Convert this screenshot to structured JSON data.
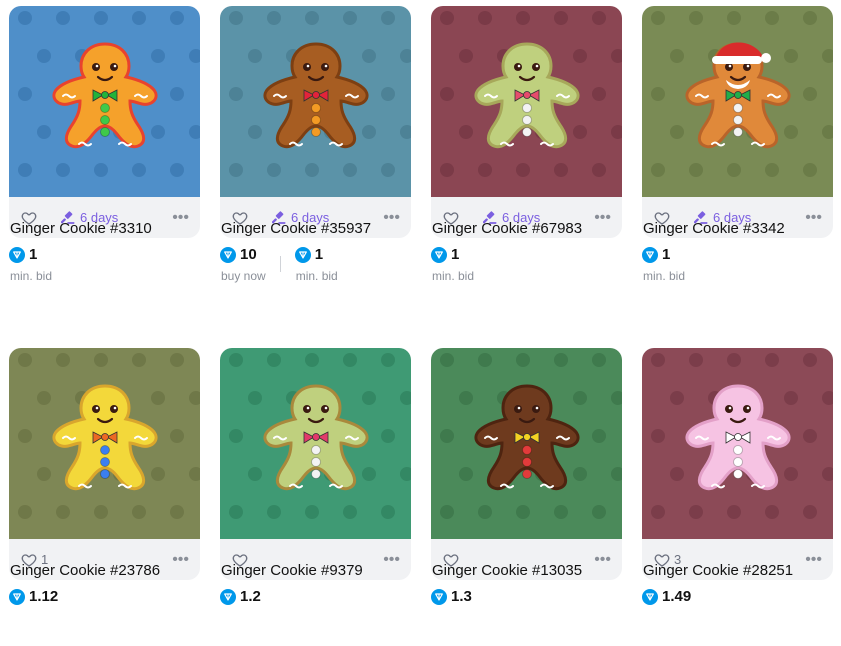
{
  "colors": {
    "accent": "#7b5fe0",
    "ton_blue": "#0098ea",
    "muted": "#8a8f98",
    "card_bar": "#f1f2f4"
  },
  "cards": [
    {
      "title": "Ginger Cookie #3310",
      "bg": "#4f8fc9",
      "pattern_color": "#3f7db6",
      "cookie_color": "#f5a12b",
      "cookie_edge": "#e8432e",
      "bow_color": "#22b33a",
      "button_color": "#3fc94a",
      "likes": "",
      "auction": "6 days",
      "prices": [
        {
          "value": "1",
          "label": "min. bid"
        }
      ]
    },
    {
      "title": "Ginger Cookie #35937",
      "bg": "#5b93a8",
      "pattern_color": "#4d8296",
      "cookie_color": "#a75d22",
      "cookie_edge": "#7d3f12",
      "bow_color": "#e3233a",
      "button_color": "#f39b24",
      "likes": "",
      "auction": "6 days",
      "prices": [
        {
          "value": "10",
          "label": "buy now"
        },
        {
          "value": "1",
          "label": "min. bid"
        }
      ]
    },
    {
      "title": "Ginger Cookie #67983",
      "bg": "#8b4653",
      "pattern_color": "#7a3a47",
      "cookie_color": "#bfd07e",
      "cookie_edge": "#a7a85a",
      "bow_color": "#e64c6c",
      "button_color": "#f3f3f3",
      "likes": "",
      "auction": "6 days",
      "prices": [
        {
          "value": "1",
          "label": "min. bid"
        }
      ]
    },
    {
      "title": "Ginger Cookie #3342",
      "bg": "#7a8b55",
      "pattern_color": "#6b7c48",
      "cookie_color": "#e0893a",
      "cookie_edge": "#b9642a",
      "bow_color": "#1fae4a",
      "button_color": "#f3f3f3",
      "likes": "",
      "auction": "6 days",
      "santa_hat": true,
      "prices": [
        {
          "value": "1",
          "label": "min. bid"
        }
      ]
    },
    {
      "title": "Ginger Cookie #23786",
      "bg": "#7e8755",
      "pattern_color": "#6f7848",
      "cookie_color": "#f3d83a",
      "cookie_edge": "#d9a62d",
      "bow_color": "#ec6a23",
      "button_color": "#3b7ff0",
      "likes": "1",
      "auction": "",
      "prices": [
        {
          "value": "1.12",
          "label": ""
        }
      ]
    },
    {
      "title": "Ginger Cookie #9379",
      "bg": "#3f9a74",
      "pattern_color": "#338864",
      "cookie_color": "#bfd07e",
      "cookie_edge": "#a9893c",
      "bow_color": "#e23a6a",
      "button_color": "#f3f3f3",
      "likes": "",
      "auction": "",
      "prices": [
        {
          "value": "1.2",
          "label": ""
        }
      ]
    },
    {
      "title": "Ginger Cookie #13035",
      "bg": "#4b8a5a",
      "pattern_color": "#3f7a4d",
      "cookie_color": "#6e3a1e",
      "cookie_edge": "#4e2410",
      "bow_color": "#f3d323",
      "button_color": "#e33b3b",
      "likes": "",
      "auction": "",
      "prices": [
        {
          "value": "1.3",
          "label": ""
        }
      ]
    },
    {
      "title": "Ginger Cookie #28251",
      "bg": "#8c4a57",
      "pattern_color": "#7b3d4a",
      "cookie_color": "#f6c3e3",
      "cookie_edge": "#e3a0c8",
      "bow_color": "#ffffff",
      "button_color": "#ffffff",
      "likes": "3",
      "auction": "",
      "prices": [
        {
          "value": "1.49",
          "label": ""
        }
      ]
    }
  ]
}
